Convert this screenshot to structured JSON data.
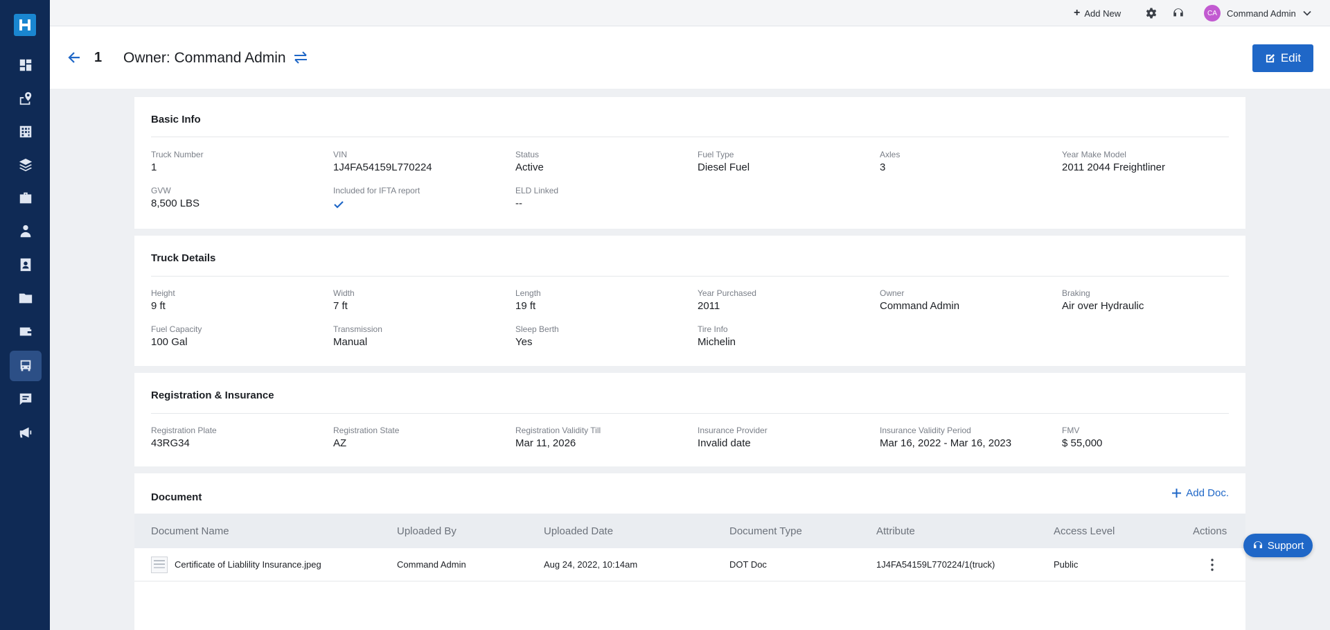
{
  "topbar": {
    "add_new": "Add New",
    "user_initials": "CA",
    "user_name": "Command Admin"
  },
  "header": {
    "truck_number": "1",
    "owner_title": "Owner: Command Admin",
    "edit_label": "Edit"
  },
  "sidebar": {
    "items": [
      "dashboard-icon",
      "map-pin-icon",
      "building-icon",
      "layers-icon",
      "briefcase-icon",
      "driver-icon",
      "contact-card-icon",
      "folder-icon",
      "wallet-icon",
      "truck-icon",
      "message-icon",
      "megaphone-icon"
    ],
    "active": "truck-icon"
  },
  "basic_info": {
    "title": "Basic Info",
    "fields": [
      {
        "label": "Truck Number",
        "value": "1"
      },
      {
        "label": "VIN",
        "value": "1J4FA54159L770224"
      },
      {
        "label": "Status",
        "value": "Active"
      },
      {
        "label": "Fuel Type",
        "value": "Diesel Fuel"
      },
      {
        "label": "Axles",
        "value": "3"
      },
      {
        "label": "Year Make Model",
        "value": "2011 2044 Freightliner"
      },
      {
        "label": "GVW",
        "value": "8,500 LBS"
      },
      {
        "label": "Included for IFTA report",
        "value": "checked"
      },
      {
        "label": "ELD Linked",
        "value": "--"
      }
    ]
  },
  "truck_details": {
    "title": "Truck Details",
    "fields": [
      {
        "label": "Height",
        "value": "9 ft"
      },
      {
        "label": "Width",
        "value": "7 ft"
      },
      {
        "label": "Length",
        "value": "19 ft"
      },
      {
        "label": "Year Purchased",
        "value": "2011"
      },
      {
        "label": "Owner",
        "value": "Command Admin"
      },
      {
        "label": "Braking",
        "value": "Air over Hydraulic"
      },
      {
        "label": "Fuel Capacity",
        "value": "100 Gal"
      },
      {
        "label": "Transmission",
        "value": "Manual"
      },
      {
        "label": "Sleep Berth",
        "value": "Yes"
      },
      {
        "label": "Tire Info",
        "value": "Michelin"
      }
    ]
  },
  "registration": {
    "title": "Registration & Insurance",
    "fields": [
      {
        "label": "Registration Plate",
        "value": "43RG34"
      },
      {
        "label": "Registration State",
        "value": "AZ"
      },
      {
        "label": "Registration Validity Till",
        "value": "Mar 11, 2026"
      },
      {
        "label": "Insurance Provider",
        "value": "Invalid date"
      },
      {
        "label": "Insurance Validity Period",
        "value": "Mar 16, 2022 - Mar 16, 2023"
      },
      {
        "label": "FMV",
        "value": "$ 55,000"
      }
    ]
  },
  "documents": {
    "title": "Document",
    "add_label": "Add Doc.",
    "columns": [
      "Document Name",
      "Uploaded By",
      "Uploaded Date",
      "Document Type",
      "Attribute",
      "Access Level",
      "Actions"
    ],
    "rows": [
      {
        "name": "Certificate of Liablility Insurance.jpeg",
        "uploaded_by": "Command Admin",
        "uploaded_date": "Aug 24, 2022, 10:14am",
        "type": "DOT Doc",
        "attribute": "1J4FA54159L770224/1(truck)",
        "access": "Public"
      }
    ]
  },
  "support_label": "Support",
  "colors": {
    "sidebar": "#0f2a55",
    "accent": "#1f67c7",
    "avatar": "#c25ad1"
  }
}
